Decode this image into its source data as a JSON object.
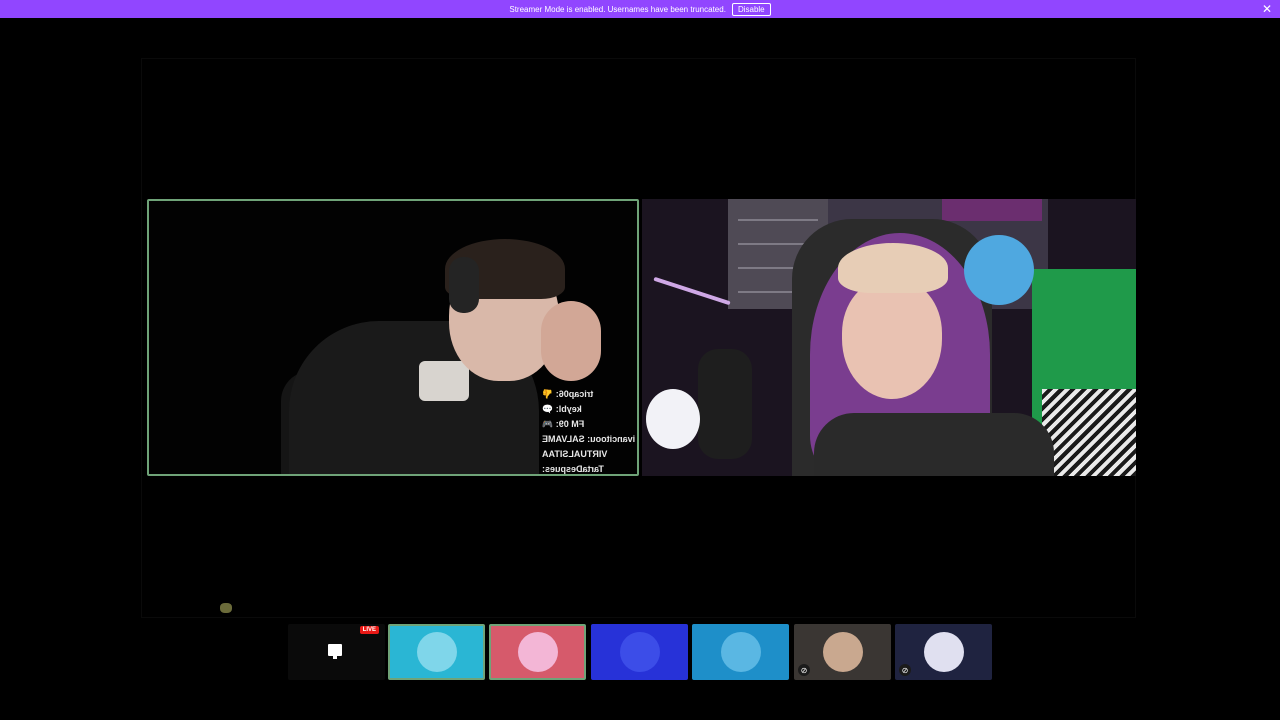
{
  "banner": {
    "message": "Streamer Mode is enabled. Usernames have been truncated.",
    "disable_label": "Disable",
    "close_glyph": "✕",
    "background": "#9146ff"
  },
  "left_stream": {
    "chat_lines": [
      "tricap06: 👎",
      "keybl: 💬",
      "FM 09: 🎮",
      "ivancitoou: SALVAME",
      "VIRTUALSITAA",
      "TartaDespues:"
    ],
    "border_color": "#6fa378"
  },
  "thumbnails": [
    {
      "type": "screen",
      "live_label": "LIVE",
      "color": "#0a0a0a",
      "muted": false
    },
    {
      "type": "avatar",
      "color": "#2ab6d4",
      "avatar_color": "#7fd6ea",
      "selected": true,
      "muted": false
    },
    {
      "type": "avatar",
      "color": "#d65a6b",
      "avatar_color": "#f3b6d6",
      "selected": true,
      "muted": false
    },
    {
      "type": "avatar",
      "color": "#2732d8",
      "avatar_color": "#3c4de8",
      "muted": false
    },
    {
      "type": "avatar",
      "color": "#1e8fc9",
      "avatar_color": "#5ab7e3",
      "muted": false
    },
    {
      "type": "avatar",
      "color": "#3a3633",
      "avatar_color": "#c9a88f",
      "muted": true
    },
    {
      "type": "avatar",
      "color": "#1f2340",
      "avatar_color": "#e0e0f0",
      "muted": true
    }
  ],
  "icons": {
    "muted": "mic-off-icon",
    "screen": "screen-share-icon"
  }
}
